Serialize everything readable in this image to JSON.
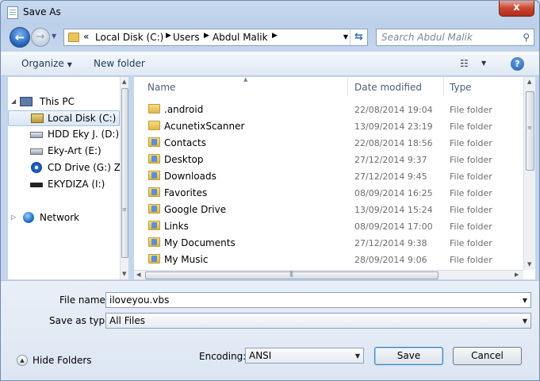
{
  "window": {
    "title": "Save As",
    "close_glyph": "x"
  },
  "nav": {
    "back_glyph": "←",
    "forward_glyph": "→",
    "overflow": "«",
    "breadcrumbs": [
      "Local Disk (C:)",
      "Users",
      "Abdul Malik"
    ],
    "search_placeholder": "Search Abdul Malik"
  },
  "toolbar": {
    "organize_label": "Organize",
    "new_folder_label": "New folder",
    "help_glyph": "?"
  },
  "sidebar": {
    "items": [
      {
        "label": "This PC",
        "icon": "computer-icon"
      },
      {
        "label": "Local Disk (C:)",
        "icon": "local-disk-icon",
        "selected": true
      },
      {
        "label": "HDD Eky J. (D:)",
        "icon": "hard-drive-icon"
      },
      {
        "label": "Eky-Art (E:)",
        "icon": "hard-drive-icon"
      },
      {
        "label": "CD Drive (G:) ZTE",
        "icon": "cd-drive-icon"
      },
      {
        "label": "EKYDIZA (I:)",
        "icon": "usb-drive-icon"
      },
      {
        "label": "Network",
        "icon": "network-icon"
      }
    ]
  },
  "files": {
    "columns": {
      "name": "Name",
      "date": "Date modified",
      "type": "Type"
    },
    "rows": [
      {
        "name": ".android",
        "date": "22/08/2014 19:04",
        "type": "File folder",
        "icon": "folder-icon"
      },
      {
        "name": "AcunetixScanner",
        "date": "13/09/2014 23:19",
        "type": "File folder",
        "icon": "folder-icon"
      },
      {
        "name": "Contacts",
        "date": "22/08/2014 18:56",
        "type": "File folder",
        "icon": "contacts-folder-icon"
      },
      {
        "name": "Desktop",
        "date": "27/12/2014 9:37",
        "type": "File folder",
        "icon": "desktop-folder-icon"
      },
      {
        "name": "Downloads",
        "date": "27/12/2014 9:45",
        "type": "File folder",
        "icon": "downloads-folder-icon"
      },
      {
        "name": "Favorites",
        "date": "08/09/2014 16:25",
        "type": "File folder",
        "icon": "favorites-folder-icon"
      },
      {
        "name": "Google Drive",
        "date": "13/09/2014 15:24",
        "type": "File folder",
        "icon": "google-drive-folder-icon"
      },
      {
        "name": "Links",
        "date": "08/09/2014 17:00",
        "type": "File folder",
        "icon": "links-folder-icon"
      },
      {
        "name": "My Documents",
        "date": "27/12/2014 9:38",
        "type": "File folder",
        "icon": "documents-folder-icon"
      },
      {
        "name": "My Music",
        "date": "28/09/2014 9:06",
        "type": "File folder",
        "icon": "music-folder-icon"
      }
    ]
  },
  "form": {
    "file_name_label": "File name:",
    "file_name_value": "iloveyou.vbs",
    "save_as_type_label": "Save as type:",
    "save_as_type_value": "All Files",
    "encoding_label": "Encoding:",
    "encoding_value": "ANSI",
    "hide_folders_label": "Hide Folders",
    "save_label": "Save",
    "cancel_label": "Cancel"
  },
  "colors": {
    "accent": "#1f5fb8",
    "close": "#c7452f",
    "selection": "#d9e6f6"
  }
}
